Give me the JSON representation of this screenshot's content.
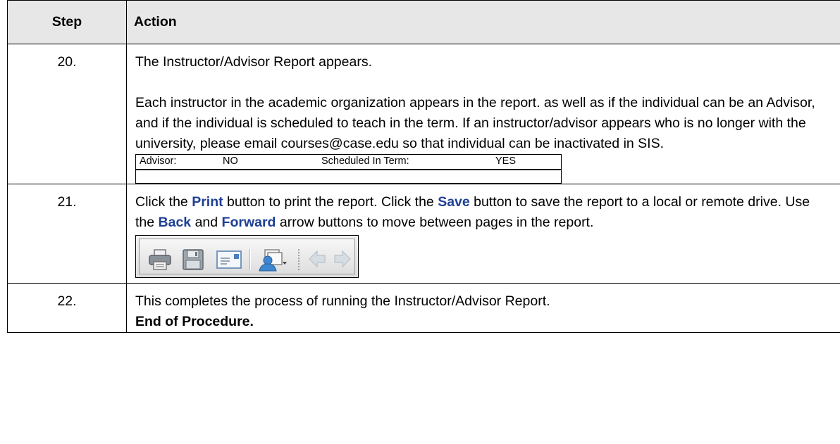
{
  "header": {
    "step": "Step",
    "action": "Action"
  },
  "rows": [
    {
      "step": "20.",
      "p1": "The Instructor/Advisor Report appears.",
      "p2": "Each instructor in the academic organization appears in the report.  as well as if the individual can be an Advisor, and if the individual is scheduled to teach in the term.  If an instructor/advisor appears who is no longer with the university, please email courses@case.edu so that individual can be inactivated in SIS.",
      "snippet": {
        "advisor_label": "Advisor:",
        "advisor_value": "NO",
        "scheduled_label": "Scheduled In Term:",
        "scheduled_value": "YES"
      }
    },
    {
      "step": "21.",
      "t1": "Click the ",
      "k1": "Print",
      "t2": " button to print the report.  Click the ",
      "k2": "Save",
      "t3": " button to save the report to a local or remote drive.  Use the ",
      "k3": "Back",
      "t4": " and ",
      "k4": "Forward",
      "t5": " arrow buttons to move between pages in the report.",
      "toolbar_icons": [
        "print-icon",
        "save-icon",
        "email-icon",
        "user-dropdown-icon",
        "back-arrow-icon",
        "forward-arrow-icon"
      ]
    },
    {
      "step": "22.",
      "p1": "This completes the process of running the Instructor/Advisor Report.",
      "end": "End of Procedure."
    }
  ],
  "colors": {
    "header_bg": "#e7e7e7",
    "keyword": "#1f3f94",
    "border": "#000000"
  }
}
